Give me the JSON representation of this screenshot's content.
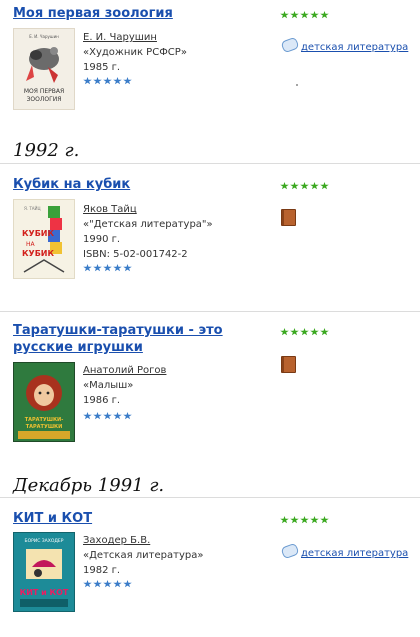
{
  "entries": [
    {
      "title": "Моя первая зоология",
      "author": "Е. И. Чарушин",
      "publisher": "«Художник РСФСР»",
      "year": "1985 г.",
      "isbn": "",
      "tag": "детская литература",
      "cover_text": [
        "Е. И. Чарушин",
        "МОЯ ПЕРВАЯ ЗООЛОГИЯ"
      ]
    },
    {
      "title": "Кубик на кубик",
      "author": "Яков Тайц",
      "publisher": "«\"Детская литература\"»",
      "year": "1990 г.",
      "isbn": "ISBN: 5-02-001742-2",
      "tag": "",
      "cover_text": [
        "Я. ТАЙЦ",
        "КУБИК НА КУБИК"
      ]
    },
    {
      "title": "Таратушки-таратушки - это русские игрушки",
      "author": "Анатолий Рогов",
      "publisher": "«Малыш»",
      "year": "1986 г.",
      "isbn": "",
      "tag": "",
      "cover_text": [
        "ТАРАТУШКИ-ТАРАТУШКИ"
      ]
    },
    {
      "title": "КИТ и КОТ",
      "author": "Заходер Б.В.",
      "publisher": "«Детская литература»",
      "year": "1982 г.",
      "isbn": "",
      "tag": "детская литература",
      "cover_text": [
        "БОРИС ЗАХОДЕР",
        "КИТ и КОТ"
      ]
    }
  ],
  "headings": [
    "1992 г.",
    "Декабрь 1991 г."
  ],
  "colors": {
    "link": "#1a4fae",
    "rating_star": "#3aa81f",
    "user_star": "#3a7cc8"
  }
}
